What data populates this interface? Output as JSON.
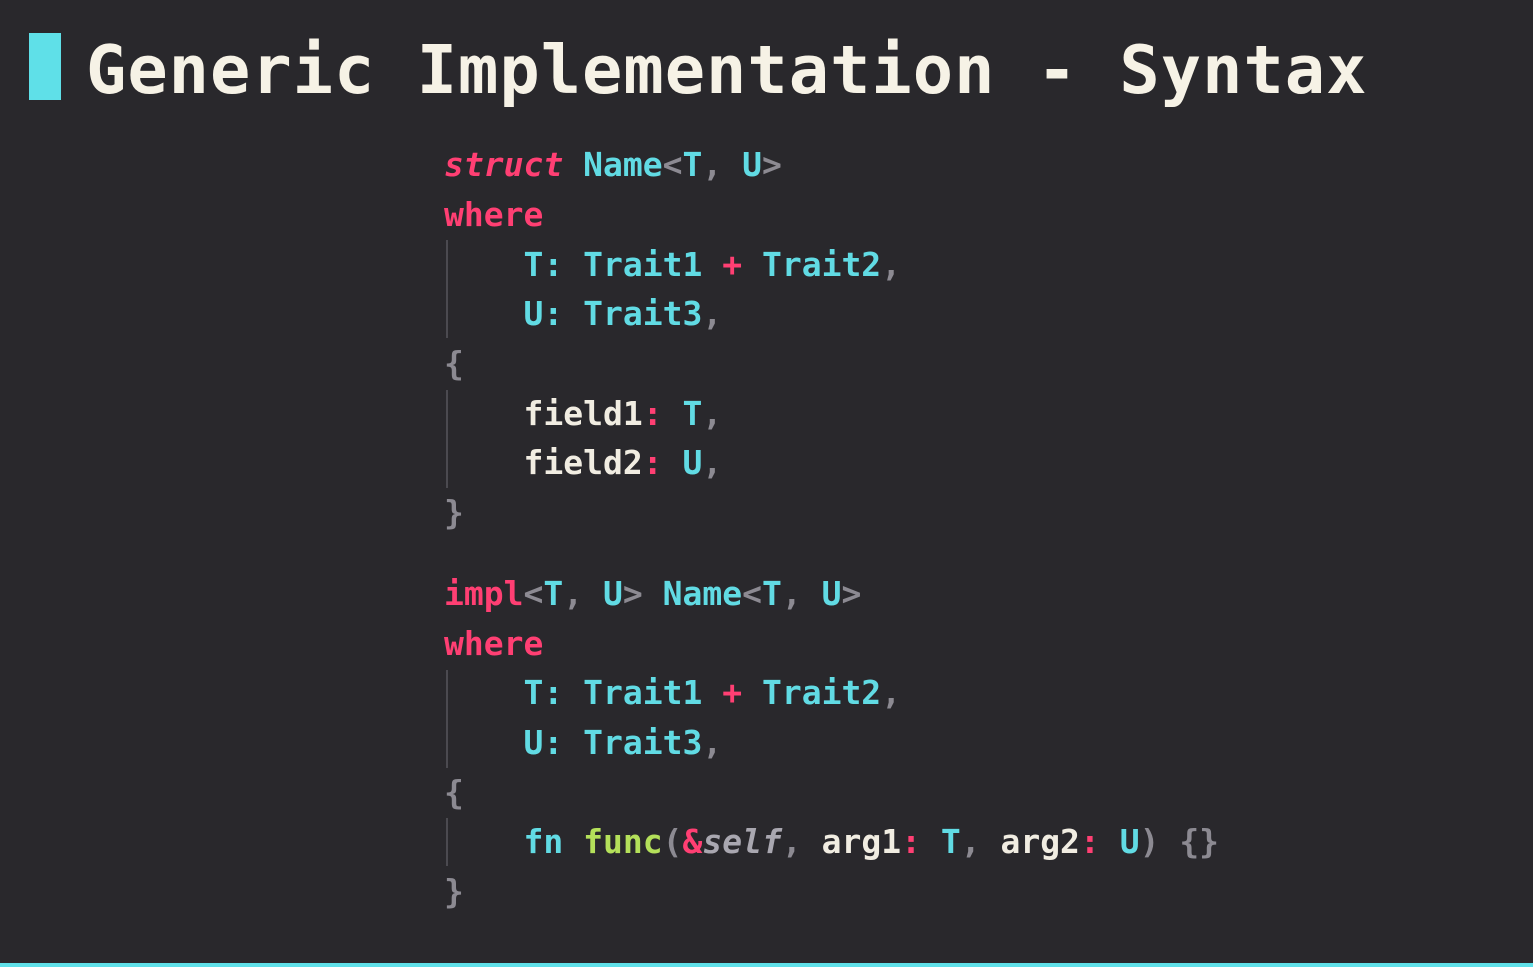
{
  "slide": {
    "title": "Generic Implementation - Syntax",
    "accent_color": "#5fe0e8",
    "background_color": "#29282c"
  },
  "code": {
    "language": "rust",
    "lines": [
      "struct Name<T, U>",
      "where",
      "    T: Trait1 + Trait2,",
      "    U: Trait3,",
      "{",
      "    field1: T,",
      "    field2: U,",
      "}",
      "",
      "impl<T, U> Name<T, U>",
      "where",
      "    T: Trait1 + Trait2,",
      "    U: Trait3,",
      "{",
      "    fn func(&self, arg1: T, arg2: U) {}",
      "}"
    ],
    "tokens": {
      "struct_kw": "struct",
      "name": "Name",
      "lt": "<",
      "gt": ">",
      "comma": ",",
      "space": " ",
      "T": "T",
      "U": "U",
      "where_kw": "where",
      "colon": ":",
      "trait1": "Trait1",
      "plus": "+",
      "trait2": "Trait2",
      "trait3": "Trait3",
      "lbrace": "{",
      "rbrace": "}",
      "field1": "field1",
      "field2": "field2",
      "impl_kw": "impl",
      "fn_kw": "fn",
      "func": "func",
      "lparen": "(",
      "rparen": ")",
      "amp": "&",
      "self_kw": "self",
      "arg1": "arg1",
      "arg2": "arg2",
      "empty_body": "{}"
    }
  },
  "colors": {
    "keyword": "#ff3f73",
    "type": "#61dbe4",
    "function": "#b4e05a",
    "identifier": "#f1ede2",
    "punctuation": "#8c8a92"
  }
}
